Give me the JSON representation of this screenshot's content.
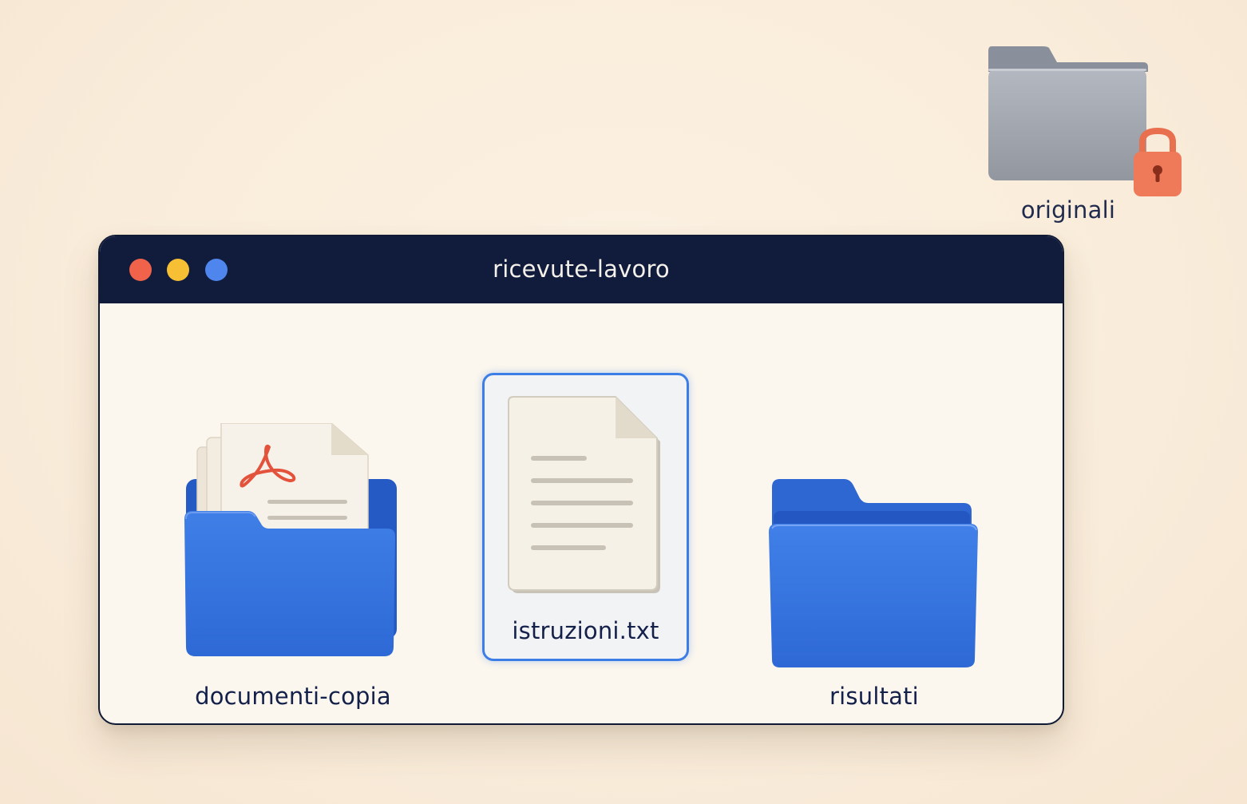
{
  "desktop": {
    "items": [
      {
        "name": "originali",
        "icon": "locked-folder-icon",
        "locked": true
      }
    ]
  },
  "window": {
    "title": "ricevute-lavoro",
    "traffic_lights": {
      "close": "#f0624a",
      "minimize": "#f6bf34",
      "zoom": "#4f86ee"
    },
    "items": [
      {
        "name": "documenti-copia",
        "icon": "folder-with-pdf-icon",
        "selected": false
      },
      {
        "name": "istruzioni.txt",
        "icon": "text-file-icon",
        "selected": true
      },
      {
        "name": "risultati",
        "icon": "folder-icon",
        "selected": false
      }
    ]
  },
  "colors": {
    "folder_blue": "#3474e0",
    "selection": "#3d7ee6",
    "titlebar": "#111c3c",
    "lock": "#ef7a5a"
  }
}
